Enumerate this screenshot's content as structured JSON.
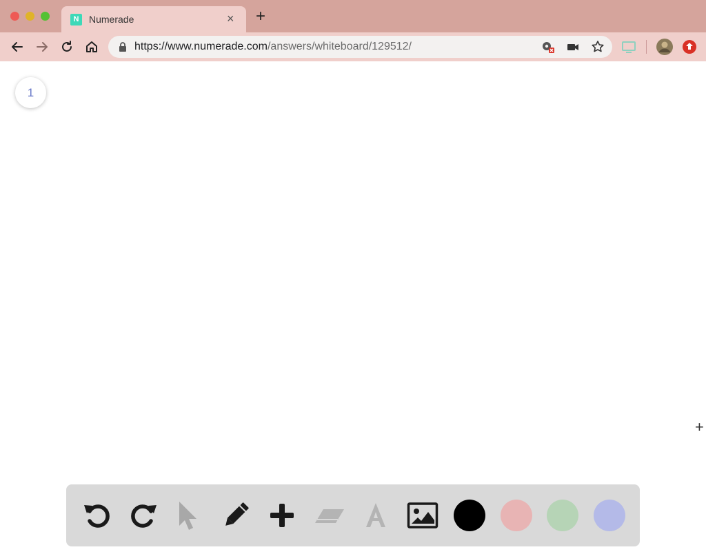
{
  "browser": {
    "tab": {
      "favicon_text": "N",
      "title": "Numerade",
      "close_glyph": "×"
    },
    "new_tab_glyph": "+",
    "url": {
      "host": "https://www.numerade.com",
      "path": "/answers/whiteboard/129512/"
    }
  },
  "icons": [
    "back-icon",
    "forward-icon",
    "reload-icon",
    "home-icon",
    "lock-icon",
    "camera-blocked-icon",
    "video-icon",
    "star-icon",
    "extension-icon",
    "profile-avatar",
    "update-icon"
  ],
  "whiteboard": {
    "page_number": "1",
    "crosshair_glyph": "+",
    "tools": [
      "undo-icon",
      "redo-icon",
      "select-icon",
      "pencil-icon",
      "add-icon",
      "eraser-icon",
      "text-icon",
      "image-icon"
    ],
    "colors": {
      "black": "#000000",
      "red": "#e8b4b4",
      "green": "#b6d4b6",
      "blue": "#b4bae8"
    }
  }
}
